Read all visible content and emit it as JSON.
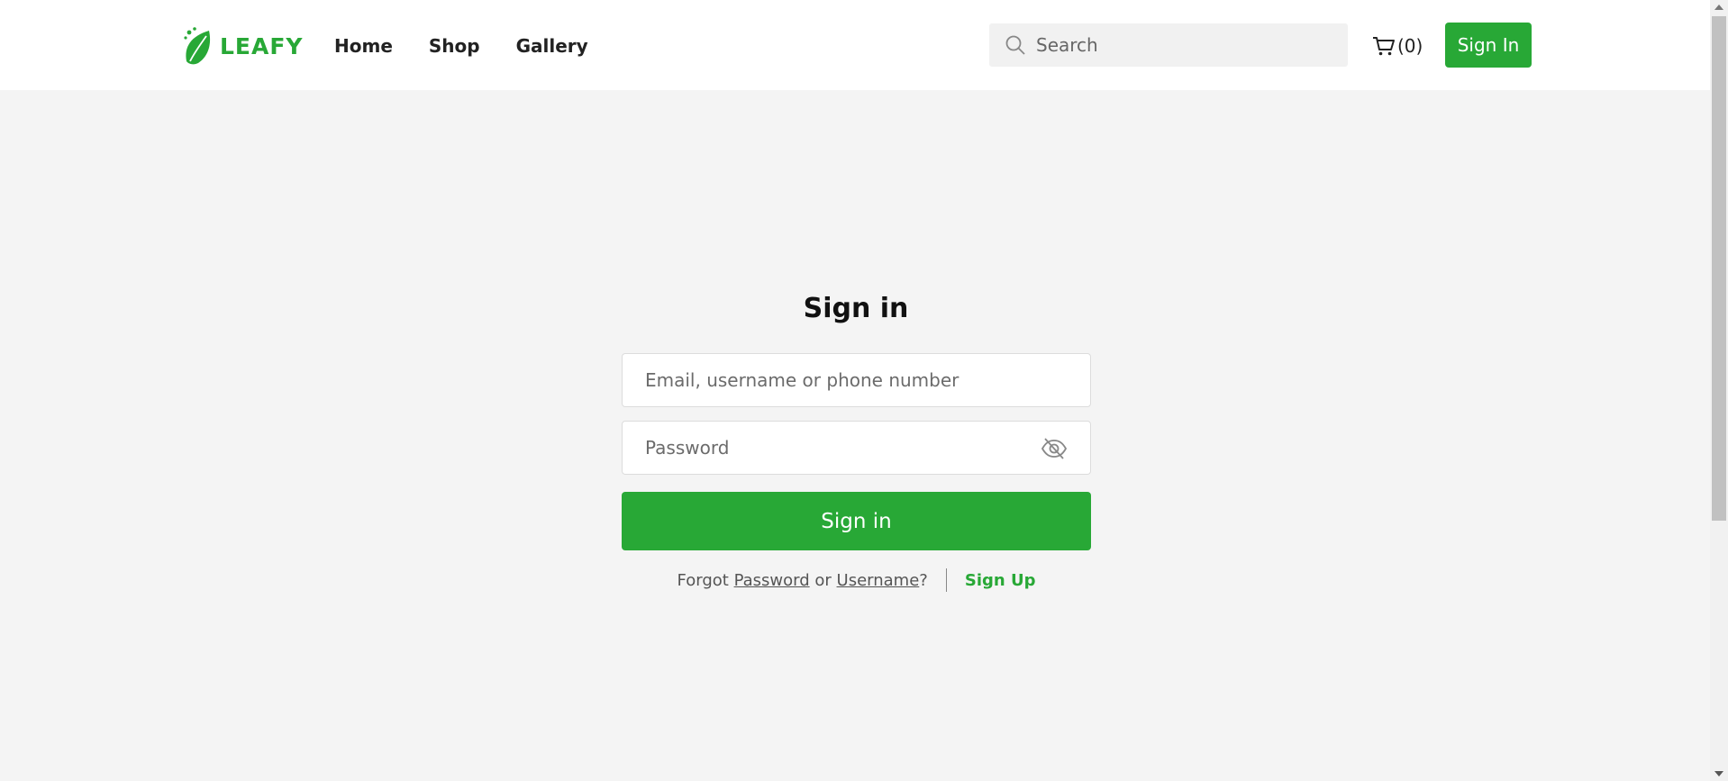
{
  "brand": {
    "name": "LEAFY",
    "accent_color": "#28a836"
  },
  "header": {
    "nav": [
      {
        "label": "Home"
      },
      {
        "label": "Shop"
      },
      {
        "label": "Gallery"
      }
    ],
    "search": {
      "placeholder": "Search",
      "icon": "search-icon"
    },
    "cart": {
      "icon": "cart-icon",
      "count_text": "(0)"
    },
    "signin_label": "Sign In"
  },
  "signin_form": {
    "title": "Sign in",
    "email_placeholder": "Email, username or phone number",
    "password_placeholder": "Password",
    "password_toggle_icon": "eye-off-icon",
    "submit_label": "Sign in",
    "forgot_prefix": "Forgot",
    "forgot_password_link": "Password",
    "forgot_or": "or",
    "forgot_username_link": "Username",
    "forgot_suffix": "?",
    "signup_label": "Sign Up"
  }
}
